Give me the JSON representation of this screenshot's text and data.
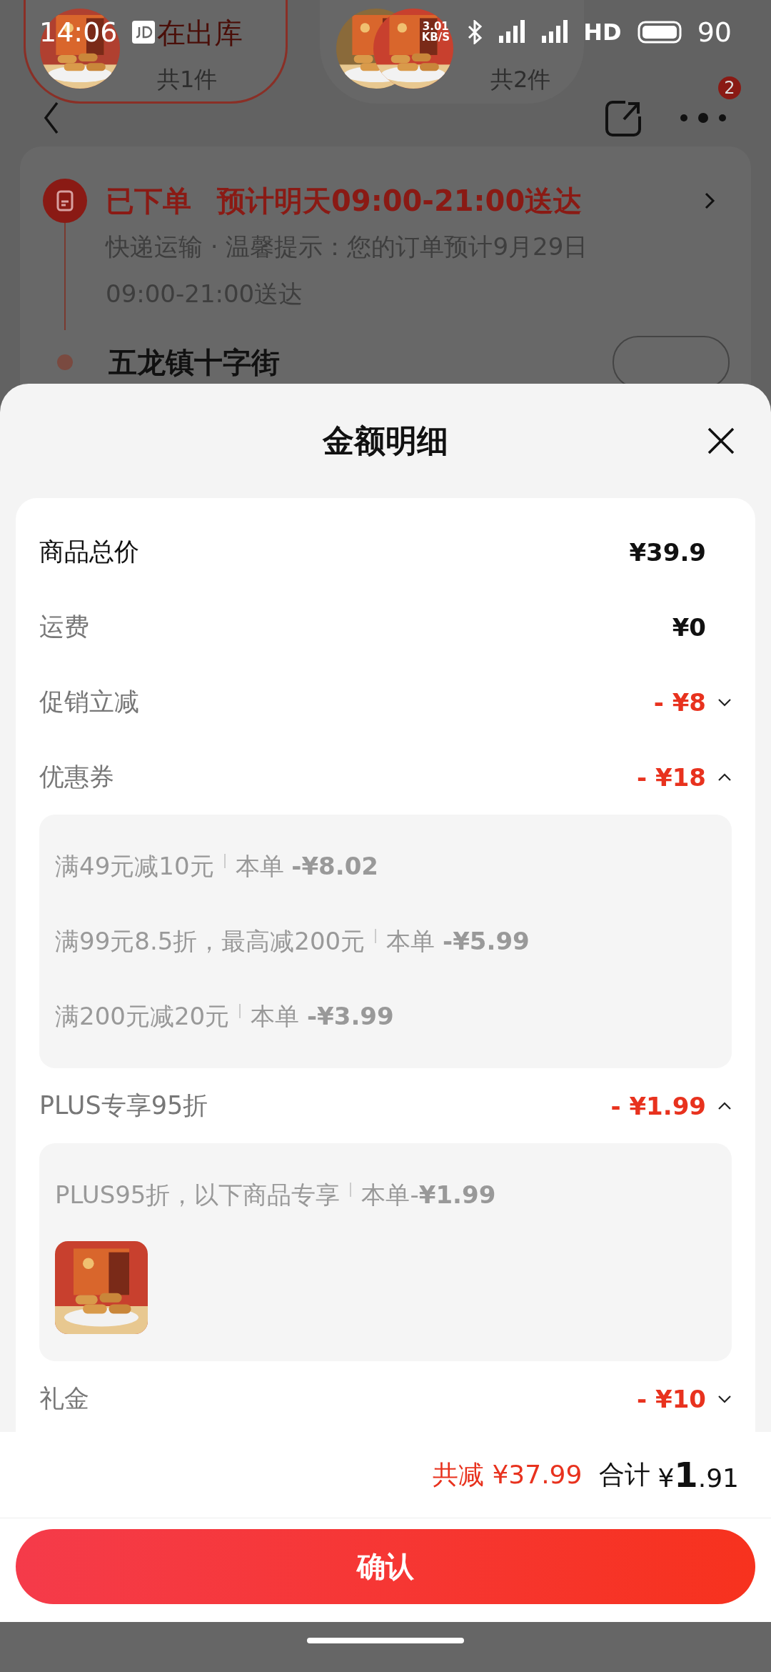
{
  "status_bar": {
    "time": "14:06",
    "net_speed": "3.01 KB/S",
    "network": "HD",
    "battery": "90"
  },
  "order_tabs": [
    {
      "label": "在出库",
      "count": "共1件",
      "selected": true,
      "thumbnails": [
        {
          "kind": "picture"
        }
      ]
    },
    {
      "count": "共2件",
      "selected": false,
      "thumbnails": [
        {
          "kind": "picture"
        },
        {
          "kind": "picture"
        }
      ]
    }
  ],
  "nav": {
    "badge": "2"
  },
  "order_status": {
    "title": "已下单",
    "eta": "预计明天09:00-21:00送达",
    "detail": "快递运输 · 温馨提示：您的订单预计9月29日09:00-21:00送达",
    "next_stop": "五龙镇十字街"
  },
  "sheet": {
    "title": "金额明细",
    "rows": [
      {
        "kind": "total",
        "label": "商品总价",
        "amount": "¥39.9"
      },
      {
        "kind": "fee",
        "label": "运费",
        "amount": "¥0"
      },
      {
        "kind": "discount",
        "label": "促销立减",
        "amount": "- ¥8",
        "expanded": false
      },
      {
        "kind": "discount",
        "label": "优惠券",
        "amount": "- ¥18",
        "expanded": true,
        "details": [
          {
            "rule": "满49元减10元",
            "saving": "本单 **-¥8.02**"
          },
          {
            "rule": "满99元8.5折，最高减200元",
            "saving": "本单 **-¥5.99**"
          },
          {
            "rule": "满200元减20元",
            "saving": "本单 **-¥3.99**"
          }
        ]
      },
      {
        "kind": "discount",
        "label": "PLUS专享95折",
        "amount": "- ¥1.99",
        "expanded": true,
        "details": [
          {
            "rule": "PLUS95折，以下商品专享",
            "saving": "本单-**¥1.99**"
          }
        ],
        "products": [
          {
            "kind": "picture"
          }
        ]
      },
      {
        "kind": "discount",
        "label": "礼金",
        "amount": "- ¥10",
        "expanded": false
      }
    ],
    "saved": "共减 ¥37.99",
    "total_label": "合计",
    "total": "¥**1**.91",
    "confirm": "确认"
  }
}
